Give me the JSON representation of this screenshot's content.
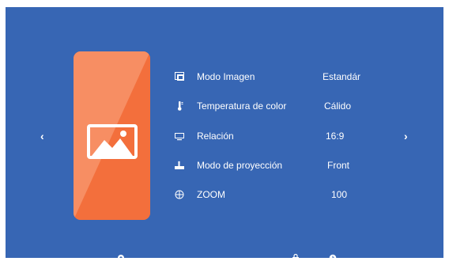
{
  "nav": {
    "prev_symbol": "‹",
    "next_symbol": "›"
  },
  "card": {
    "icon": "image-icon",
    "color": "#f36f3c"
  },
  "settings": [
    {
      "icon": "picture-mode-icon",
      "label": "Modo Imagen",
      "value": "Estandár"
    },
    {
      "icon": "thermometer-icon",
      "label": "Temperatura de color",
      "value": "Cálido"
    },
    {
      "icon": "aspect-ratio-icon",
      "label": "Relación",
      "value": "16:9"
    },
    {
      "icon": "projector-icon",
      "label": "Modo de proyección",
      "value": "Front"
    },
    {
      "icon": "zoom-icon",
      "label": "ZOOM",
      "value": "100"
    }
  ],
  "bottom_icons": [
    "settings-icon",
    "lock-icon",
    "clock-icon"
  ],
  "colors": {
    "background": "#3766b4",
    "accent": "#f36f3c",
    "text": "#ffffff"
  }
}
